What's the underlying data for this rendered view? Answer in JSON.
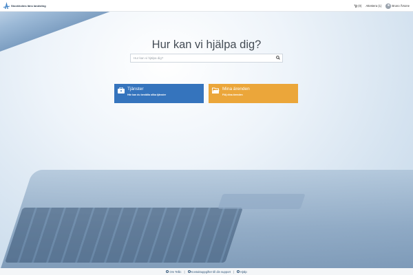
{
  "header": {
    "logo_text": "Stockholms läns landsting",
    "cart_label": "(0)",
    "approvals_label": "Attestera (1)",
    "user_name": "Bruno Årsone"
  },
  "hero": {
    "title": "Hur kan vi hjälpa dig?",
    "search_placeholder": "Hur kan vi hjälpa dig?"
  },
  "cards": [
    {
      "title": "Tjänster",
      "subtitle": "Här kan du beställa olika tjänster",
      "color": "#3574bd",
      "icon": "briefcase-icon"
    },
    {
      "title": "Mina ärenden",
      "subtitle": "Följ dina ärenden",
      "color": "#eba63a",
      "icon": "folder-icon"
    }
  ],
  "footer": {
    "links": [
      {
        "label": "Om Tellic",
        "icon": "info-icon"
      },
      {
        "label": "Kontaktuppgifter till din support",
        "icon": "contact-icon"
      },
      {
        "label": "Hjälp",
        "icon": "help-icon"
      }
    ]
  }
}
